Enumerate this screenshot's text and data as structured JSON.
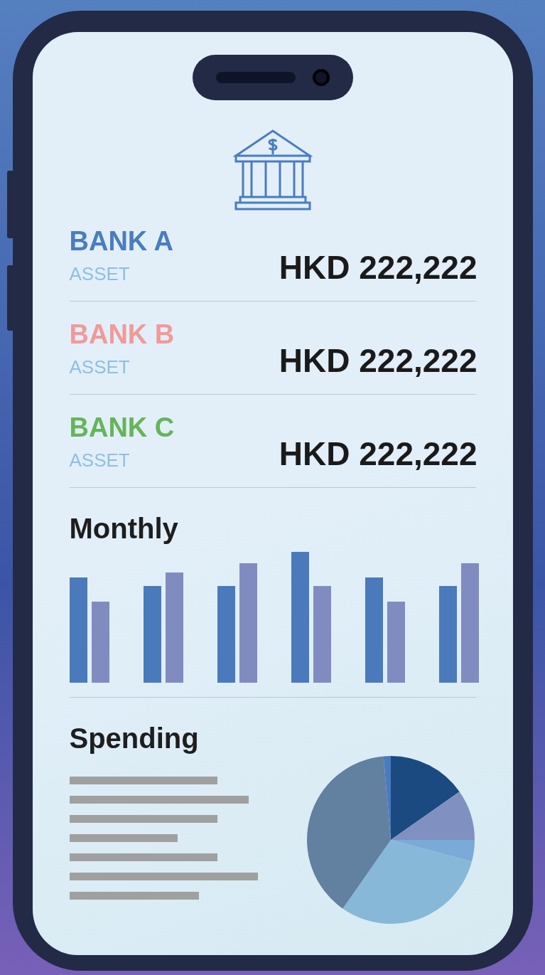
{
  "banks": [
    {
      "name": "BANK A",
      "color": "#4a7cc0",
      "label": "ASSET",
      "amount": "HKD 222,222"
    },
    {
      "name": "BANK B",
      "color": "#f09a9a",
      "label": "ASSET",
      "amount": "HKD 222,222"
    },
    {
      "name": "BANK C",
      "color": "#66b45a",
      "label": "ASSET",
      "amount": "HKD 222,222"
    }
  ],
  "monthly": {
    "title": "Monthly"
  },
  "spending": {
    "title": "Spending"
  }
}
